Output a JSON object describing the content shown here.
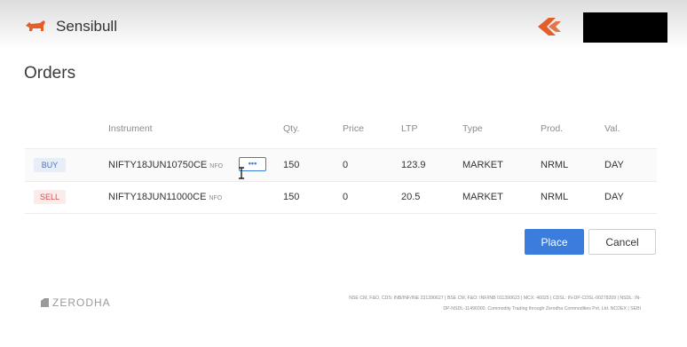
{
  "header": {
    "brand": "Sensibull",
    "brand_icon": "bull-logo-icon",
    "kite_icon": "kite-logo-icon",
    "accent_color": "#e25f2a"
  },
  "title": "Orders",
  "table": {
    "headers": [
      "Instrument",
      "Qty.",
      "Price",
      "LTP",
      "Type",
      "Prod.",
      "Val."
    ],
    "rows": [
      {
        "side": "BUY",
        "instrument": "NIFTY18JUN10750CE",
        "exchange": "NFO",
        "qty": "150",
        "price": "0",
        "ltp": "123.9",
        "type": "MARKET",
        "prod": "NRML",
        "val": "DAY"
      },
      {
        "side": "SELL",
        "instrument": "NIFTY18JUN11000CE",
        "exchange": "NFO",
        "qty": "150",
        "price": "0",
        "ltp": "20.5",
        "type": "MARKET",
        "prod": "NRML",
        "val": "DAY"
      }
    ],
    "more_label": "•••"
  },
  "actions": {
    "place": "Place",
    "cancel": "Cancel",
    "primary_color": "#3b7ddd"
  },
  "footer": {
    "logo": "ZERODHA",
    "disclaimer_line1": "NSE CM, F&O, CDS: INB/INF/INE 231390627 | BSE CM, F&O: INF/INB 011390623 | MCX: 46025 | CDSL: IN-DP-CDSL-00278209 | NSDL: IN-",
    "disclaimer_line2": "DP-NSDL-11496000. Commodity Trading through Zerodha Commodities Pvt. Ltd. NCDEX | SEBI"
  }
}
